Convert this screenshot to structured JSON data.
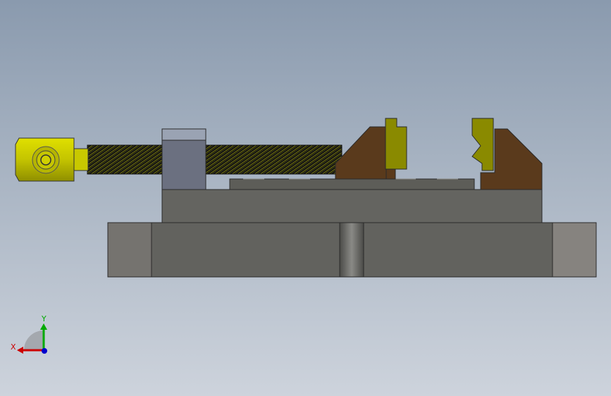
{
  "model": {
    "parts": [
      {
        "name": "handle-knob",
        "color": "#c8c800"
      },
      {
        "name": "lead-screw",
        "color": "#1a1a1a",
        "thread_color": "#d4d400"
      },
      {
        "name": "screw-bearing-block",
        "color": "#6b7080",
        "cap_color": "#9aa3b3"
      },
      {
        "name": "vise-body",
        "color": "#646460"
      },
      {
        "name": "slide-rail",
        "color": "#5d5d58"
      },
      {
        "name": "base-plate",
        "color": "#62625e"
      },
      {
        "name": "base-end-caps",
        "color": "#86837f"
      },
      {
        "name": "movable-jaw",
        "color": "#5a3a1c"
      },
      {
        "name": "fixed-jaw",
        "color": "#5a3a1c"
      },
      {
        "name": "jaw-plates",
        "color": "#8a8a00"
      }
    ]
  },
  "triad": {
    "x_label": "X",
    "y_label": "Y",
    "x_color": "#cc0000",
    "y_color": "#00aa00",
    "z_color": "#0000cc"
  }
}
